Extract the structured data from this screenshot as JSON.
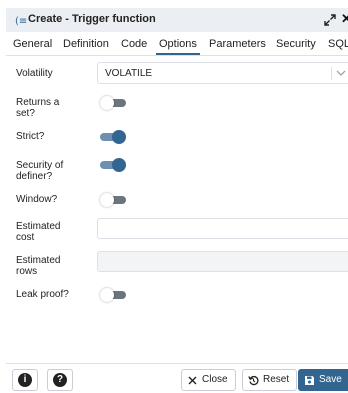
{
  "dialog": {
    "title": "Create - Trigger function"
  },
  "tabs": [
    {
      "label": "General"
    },
    {
      "label": "Definition"
    },
    {
      "label": "Code"
    },
    {
      "label": "Options",
      "active": true
    },
    {
      "label": "Parameters"
    },
    {
      "label": "Security"
    },
    {
      "label": "SQL"
    }
  ],
  "fields": {
    "volatility": {
      "label": "Volatility",
      "value": "VOLATILE"
    },
    "returns_set": {
      "label": "Returns a set?",
      "checked": false
    },
    "strict": {
      "label": "Strict?",
      "checked": true
    },
    "security_definer": {
      "label": "Security of definer?",
      "checked": true
    },
    "window": {
      "label": "Window?",
      "checked": false
    },
    "estimated_cost": {
      "label": "Estimated cost",
      "value": ""
    },
    "estimated_rows": {
      "label": "Estimated rows",
      "value": "",
      "disabled": true
    },
    "leak_proof": {
      "label": "Leak proof?",
      "checked": false
    }
  },
  "footer": {
    "info_label": "i",
    "help_label": "?",
    "close_label": "Close",
    "reset_label": "Reset",
    "save_label": "Save"
  },
  "colors": {
    "accent": "#326690",
    "toggle_off": "#6c757d",
    "border": "#dde0e6",
    "titlebar_bg": "#ebeef3"
  }
}
